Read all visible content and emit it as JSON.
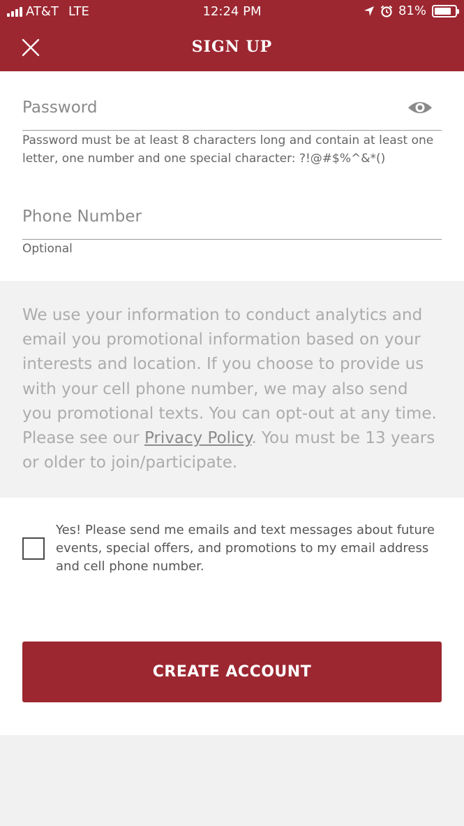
{
  "status_bar": {
    "carrier": "AT&T",
    "network": "LTE",
    "time": "12:24 PM",
    "battery": "81%",
    "battery_level": 0.81,
    "icons": [
      "signal-icon",
      "location-arrow-icon",
      "alarm-icon",
      "battery-icon"
    ]
  },
  "header": {
    "title": "SIGN UP",
    "close_icon": "close-icon",
    "background_color": "#9c2731"
  },
  "password": {
    "placeholder": "Password",
    "value": "",
    "toggle_icon": "eye-icon",
    "hint": "Password must be at least 8 characters long and contain at least one letter, one number and one special character: ?!@#$%^&*()"
  },
  "phone": {
    "placeholder": "Phone Number",
    "value": "",
    "hint": "Optional"
  },
  "notice": {
    "text_before": "We use your information to conduct analytics and email you promotional information based on your interests and location. If you choose to provide us with your cell phone number, we may also send you promotional texts. You can opt-out at any time. Please see our ",
    "link_text": "Privacy Policy",
    "text_after": ". You must be 13 years or older to join/participate."
  },
  "consent": {
    "checked": false,
    "label": "Yes! Please send me emails and text messages about future events, special offers, and promotions to my email address and cell phone number."
  },
  "submit": {
    "label": "CREATE ACCOUNT"
  }
}
